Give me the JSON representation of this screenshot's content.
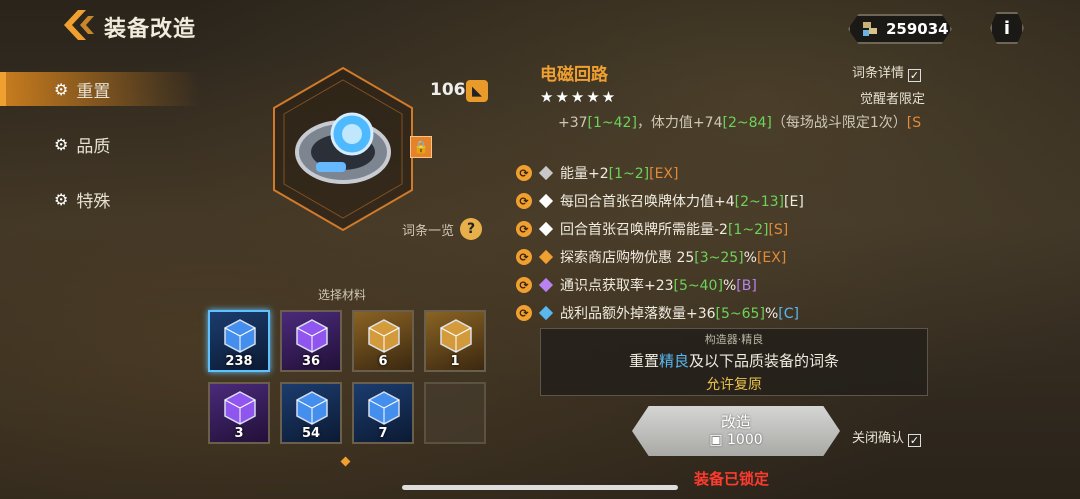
{
  "header": {
    "title": "装备改造",
    "currency": "259034",
    "info": "i"
  },
  "nav": [
    {
      "label": "重置",
      "active": true
    },
    {
      "label": "品质",
      "active": false
    },
    {
      "label": "特殊",
      "active": false
    }
  ],
  "item": {
    "level": "106",
    "lock": "🔒",
    "entry_list": "词条一览",
    "qmark": "?"
  },
  "materials": {
    "label": "选择材料",
    "slots": [
      {
        "count": "238",
        "quality": "blue",
        "selected": true
      },
      {
        "count": "36",
        "quality": "purple",
        "selected": false
      },
      {
        "count": "6",
        "quality": "gold",
        "selected": false
      },
      {
        "count": "1",
        "quality": "gold",
        "selected": false
      },
      {
        "count": "3",
        "quality": "purple",
        "selected": false
      },
      {
        "count": "54",
        "quality": "blue",
        "selected": false
      },
      {
        "count": "7",
        "quality": "blue",
        "selected": false
      },
      {
        "count": "",
        "quality": "empty",
        "selected": false
      }
    ]
  },
  "equipment": {
    "name": "电磁回路",
    "stars": "★★★★★",
    "detail_label": "词条详情",
    "awaken_label": "觉醒者限定",
    "line0": {
      "a": "+37",
      "b": "[1~42]",
      "c": "，体力值+74",
      "d": "[2~84]",
      "e": "（每场战斗限定1次）",
      "f": "[S"
    },
    "stats": [
      {
        "pre": "能量+2",
        "range": "[1~2]",
        "suf": "",
        "tag": "[EX]",
        "dia": "#c8c8c8",
        "rcol": "grn",
        "tcol": "org"
      },
      {
        "pre": "每回合首张召唤牌体力值+4",
        "range": "[2~13]",
        "suf": "",
        "tag": "[E]",
        "dia": "#ffffff",
        "rcol": "grn",
        "tcol": "wht"
      },
      {
        "pre": "回合首张召唤牌所需能量-2",
        "range": "[1~2]",
        "suf": "",
        "tag": "[S]",
        "dia": "#ffffff",
        "rcol": "grn",
        "tcol": "org"
      },
      {
        "pre": "探索商店购物优惠 25",
        "range": "[3~25]",
        "suf": "%",
        "tag": "[EX]",
        "dia": "#f0a030",
        "rcol": "grn",
        "tcol": "org"
      },
      {
        "pre": "通识点获取率+23",
        "range": "[5~40]",
        "suf": "%",
        "tag": "[B]",
        "dia": "#b882f0",
        "rcol": "grn",
        "tcol": "pur"
      },
      {
        "pre": "战利品额外掉落数量+36",
        "range": "[5~65]",
        "suf": "%",
        "tag": "[C]",
        "dia": "#5ab8f0",
        "rcol": "grn",
        "tcol": "blu"
      }
    ]
  },
  "forge_box": {
    "header": "构造器·精良",
    "l1a": "重置",
    "l1b": "精良",
    "l1c": "及以下品质装备的词条",
    "l2": "允许复原"
  },
  "forge": {
    "label": "改造",
    "cost": "1000",
    "close_confirm": "关闭确认",
    "locked": "装备已锁定"
  }
}
